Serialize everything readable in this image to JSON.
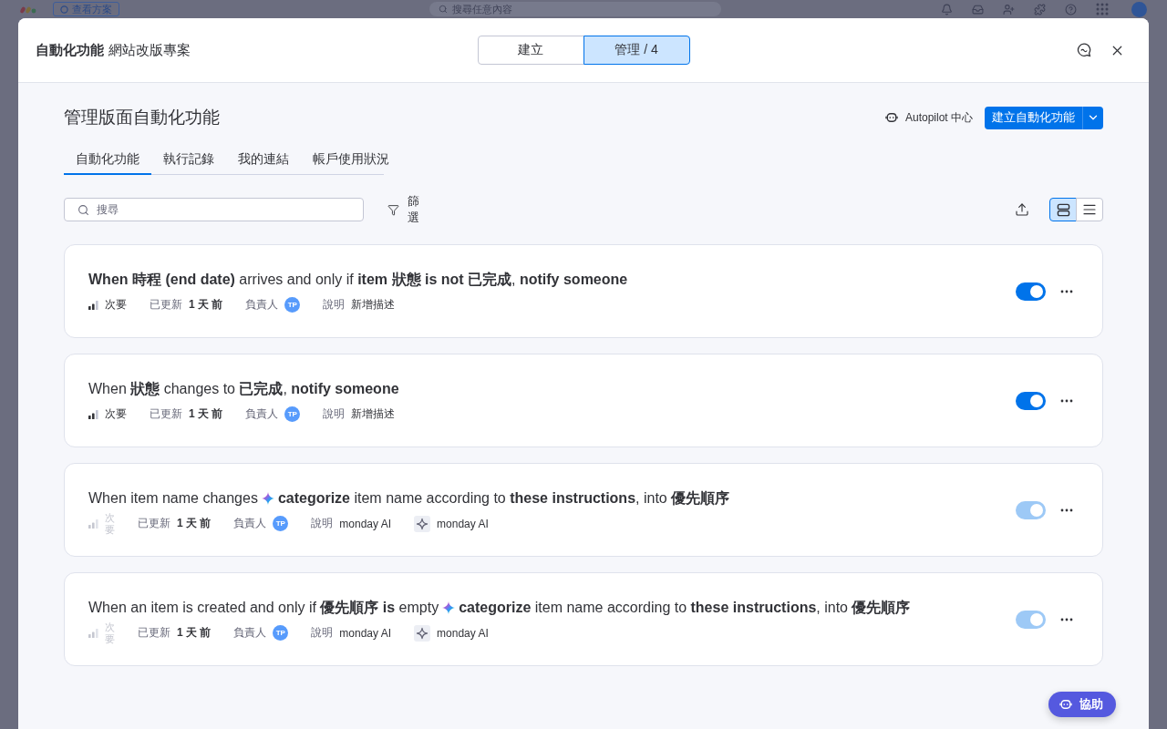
{
  "backdrop": {
    "plan_button": "查看方案",
    "search": {
      "placeholder": "搜尋任意內容"
    }
  },
  "window": {
    "title": "自動化功能",
    "board": "網站改版專案"
  },
  "mode_tabs": [
    {
      "label": "建立",
      "selected": false
    },
    {
      "label": "管理 / 4",
      "selected": true
    }
  ],
  "page": {
    "title": "管理版面自動化功能",
    "autopilot_link": "Autopilot 中心",
    "create_button": "建立自動化功能"
  },
  "tabs": [
    {
      "label": "自動化功能",
      "selected": true
    },
    {
      "label": "執行記錄",
      "selected": false
    },
    {
      "label": "我的連結",
      "selected": false
    },
    {
      "label": "帳戶使用狀況",
      "selected": false
    }
  ],
  "search": {
    "placeholder": "搜尋"
  },
  "filter_button": "篩選",
  "view_modes": [
    {
      "kind": "cards",
      "selected": true
    },
    {
      "kind": "list",
      "selected": false
    }
  ],
  "automations": [
    {
      "title": "**When 時程 (end date)** arrives and only if **item 狀態 is not 已完成**, **notify someone**",
      "priority": "次要",
      "updated_label": "已更新",
      "updated": "1 天 前",
      "owner_label": "負責人",
      "owner": "TP",
      "description_label": "說明",
      "description": "新增描述",
      "on": true,
      "disabled": false
    },
    {
      "title": "When **狀態** changes to **已完成**, **notify someone**",
      "priority": "次要",
      "updated_label": "已更新",
      "updated": "1 天 前",
      "owner_label": "負責人",
      "owner": "TP",
      "description_label": "說明",
      "description": "新增描述",
      "on": true,
      "disabled": false
    },
    {
      "title": "When item name changes",
      "ai_step": "**categorize** item name according to **these instructions**, into **優先順序**",
      "priority": "次要",
      "updated_label": "已更新",
      "updated": "1 天 前",
      "owner_label": "負責人",
      "owner": "TP",
      "description_label": "說明",
      "description": "monday AI",
      "agent": "monday AI",
      "on": true,
      "disabled": true
    },
    {
      "title": "When an item is created and only if **優先順序 is** empty",
      "ai_step": "**categorize** item name according to **these instructions**, into **優先順序**",
      "priority": "次要",
      "updated_label": "已更新",
      "updated": "1 天 前",
      "owner_label": "負責人",
      "owner": "TP",
      "description_label": "說明",
      "description": "monday AI",
      "agent": "monday AI",
      "on": true,
      "disabled": true
    }
  ],
  "assist_button": "協助"
}
